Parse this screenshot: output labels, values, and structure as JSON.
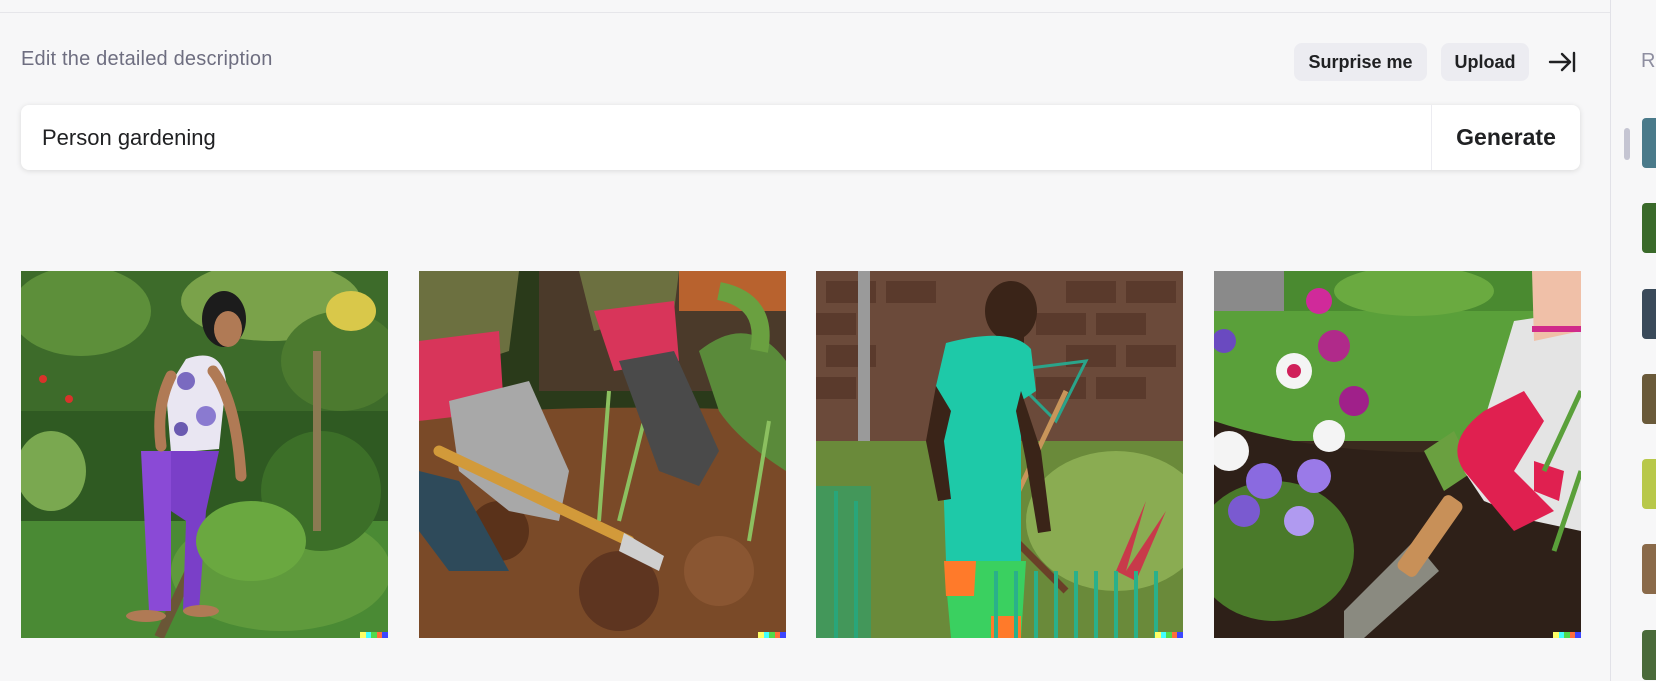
{
  "header": {
    "heading": "Edit the detailed description",
    "surprise_label": "Surprise me",
    "upload_label": "Upload",
    "collapse_icon": "collapse-sidebar-icon"
  },
  "prompt": {
    "value": "Person gardening",
    "generate_label": "Generate"
  },
  "results": [
    {
      "name": "woman-gardening-image",
      "description": "image 1"
    },
    {
      "name": "gloved-hands-soil-image",
      "description": "image 2"
    },
    {
      "name": "man-raking-garden-image",
      "description": "image 3"
    },
    {
      "name": "hand-trowel-flowers-image",
      "description": "image 4"
    }
  ],
  "sidebar": {
    "title": "R",
    "thumbnail_count": 7
  },
  "colors": {
    "background": "#f7f7f8",
    "button": "#ececf1",
    "text": "#202123",
    "muted": "#6e6e80"
  }
}
